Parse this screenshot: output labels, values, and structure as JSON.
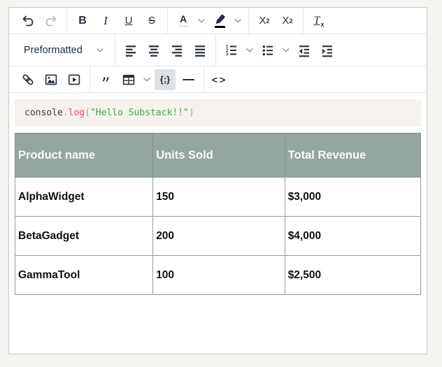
{
  "colors": {
    "page_background": "#f6f5f2",
    "editor_background": "#ffffff",
    "frame_border": "#c7c8ca",
    "icon": "#222f3e",
    "icon_disabled": "#b9bec4",
    "chevron": "#8f979e",
    "active_button_bg": "#dee0e2",
    "text_color_swatch": "#e8eaec",
    "highlight_color_swatch": "#000000",
    "code_block_bg": "#f5f1ec",
    "code_plain": "#383a42",
    "code_punct": "#9da0a6",
    "code_function": "#e0507a",
    "code_string": "#50a14f",
    "table_header_bg": "#95a5a1",
    "table_header_text": "#fafafa",
    "table_body_text": "#101010"
  },
  "icons": {
    "undo": "curved-arrow-left",
    "redo": "curved-arrow-right (disabled)",
    "text_color": "letter-A-with-color-bar",
    "highlight_color": "marker-pen-with-black-bar",
    "align_left": "bars-left",
    "align_center": "bars-center",
    "align_right": "bars-right",
    "align_justify": "bars-justify",
    "numbered_list": "123-list",
    "bullet_list": "dot-list",
    "outdent": "bars-arrow-left",
    "indent": "bars-arrow-right",
    "link": "chain-link",
    "image": "picture-frame",
    "media": "play-video",
    "blockquote": "double-quote",
    "table": "grid-with-header",
    "horizontal_rule": "dash",
    "chevron": "chevron-down"
  },
  "toolbar": {
    "bold_label": "B",
    "italic_label": "I",
    "underline_label": "U",
    "strikethrough_label": "S",
    "text_color_label": "A",
    "superscript_base": "X",
    "superscript_exp": "2",
    "subscript_base": "X",
    "subscript_sub": "2",
    "clear_format_base": "T",
    "clear_format_x": "x",
    "format_select_value": "Preformatted",
    "blockquote_glyph": "”",
    "code_sample_label": "{;}",
    "source_code_label": "<>",
    "ol_digits": [
      "1",
      "2",
      "3"
    ],
    "code_sample_active": true,
    "redo_disabled": true
  },
  "code_block": {
    "language": "javascript",
    "text": "console.log(\"Hello Substack!!\")",
    "tokens": [
      {
        "text": "console",
        "type": "plain"
      },
      {
        "text": ".",
        "type": "punct"
      },
      {
        "text": "log",
        "type": "function"
      },
      {
        "text": "(",
        "type": "punct"
      },
      {
        "text": "\"Hello Substack!!\"",
        "type": "string"
      },
      {
        "text": ")",
        "type": "punct"
      }
    ]
  },
  "table": {
    "headers": [
      "Product name",
      "Units Sold",
      "Total Revenue"
    ],
    "rows": [
      [
        "AlphaWidget",
        "150",
        "$3,000"
      ],
      [
        "BetaGadget",
        "200",
        "$4,000"
      ],
      [
        "GammaTool",
        "100",
        "$2,500"
      ]
    ]
  }
}
